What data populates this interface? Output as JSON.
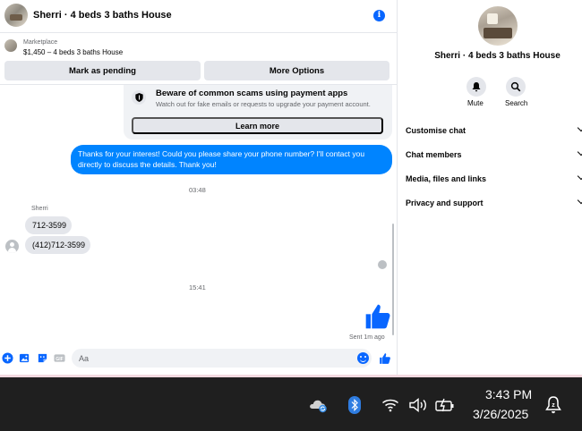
{
  "header": {
    "title": "Sherri · 4 beds 3 baths House",
    "info_icon": "info-icon"
  },
  "listing": {
    "label": "Marketplace",
    "price_title": "$1,450 – 4 beds 3 baths House"
  },
  "actions": {
    "pending_label": "Mark as pending",
    "more_label": "More Options"
  },
  "scam_warning": {
    "title": "Beware of common scams using payment apps",
    "subtitle": "Watch out for fake emails or requests to upgrade your payment account.",
    "button_label": "Learn more"
  },
  "messages": {
    "outgoing_1": "Thanks for your interest! Could you please share your phone number? I'll contact you directly to discuss the details. Thank you!",
    "time_1": "03:48",
    "sender_name": "Sherri",
    "incoming_1": "712-3599",
    "incoming_2": "(412)712-3599",
    "time_2": "15:41",
    "sent_status": "Sent 1m ago"
  },
  "composer": {
    "placeholder": "Aa"
  },
  "side_panel": {
    "title": "Sherri · 4 beds 3 baths House",
    "mute_label": "Mute",
    "search_label": "Search",
    "items": [
      {
        "label": "Customise chat"
      },
      {
        "label": "Chat members"
      },
      {
        "label": "Media, files and links"
      },
      {
        "label": "Privacy and support"
      }
    ]
  },
  "taskbar": {
    "time": "3:43 PM",
    "date": "3/26/2025"
  },
  "colors": {
    "accent": "#0866ff",
    "outgoing_bubble": "#0084ff",
    "taskbar_bg": "#1f1f1f"
  }
}
